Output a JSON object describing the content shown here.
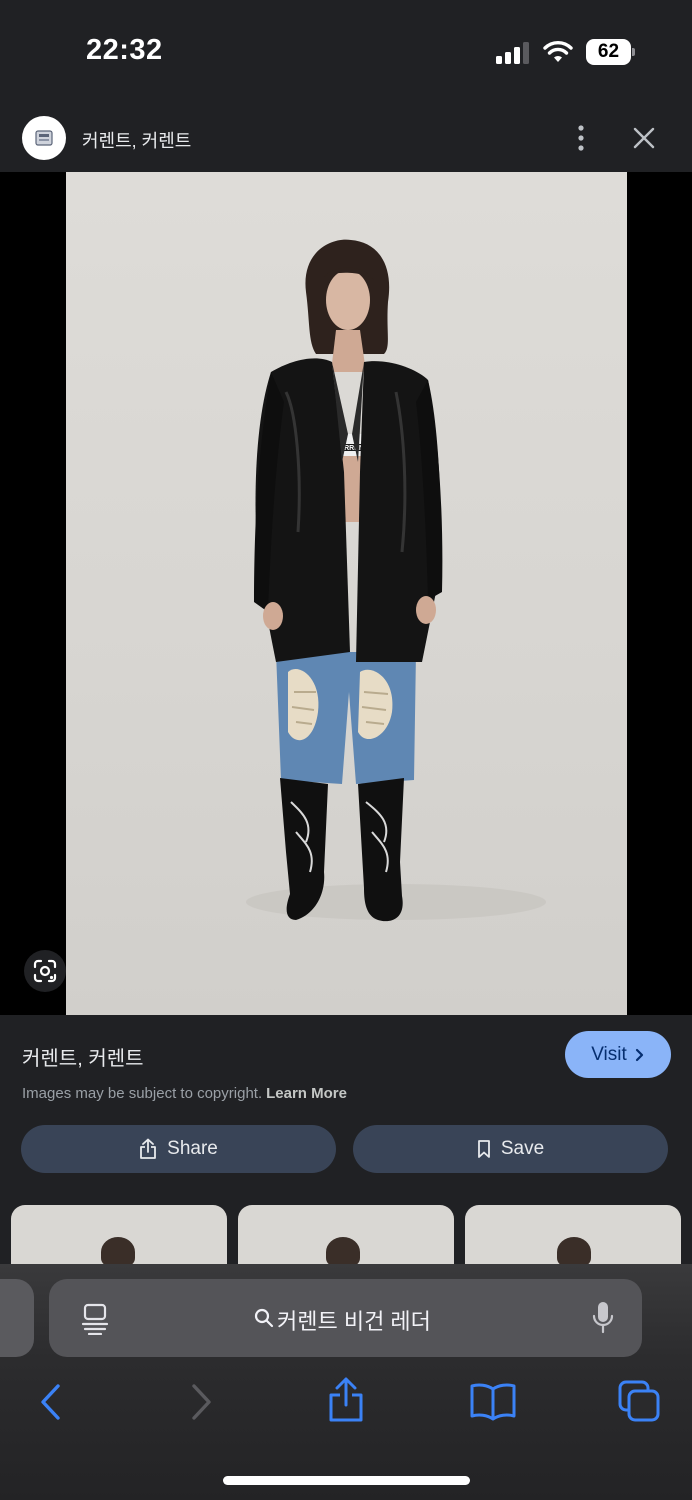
{
  "status_bar": {
    "time": "22:32",
    "battery_level": "62"
  },
  "header": {
    "site_name": "커렌트, 커렌트"
  },
  "image": {
    "print_text": "CURREN"
  },
  "info": {
    "title": "커렌트, 커렌트",
    "visit_label": "Visit",
    "copyright_text": "Images may be subject to copyright.",
    "learn_more_label": "Learn More",
    "share_label": "Share",
    "save_label": "Save"
  },
  "safari": {
    "url_text": "커렌트 비건 레더"
  },
  "colors": {
    "background": "#202124",
    "visit_button": "#8ab4f8",
    "action_button": "#394457",
    "safari_blue": "#3b82f6"
  }
}
